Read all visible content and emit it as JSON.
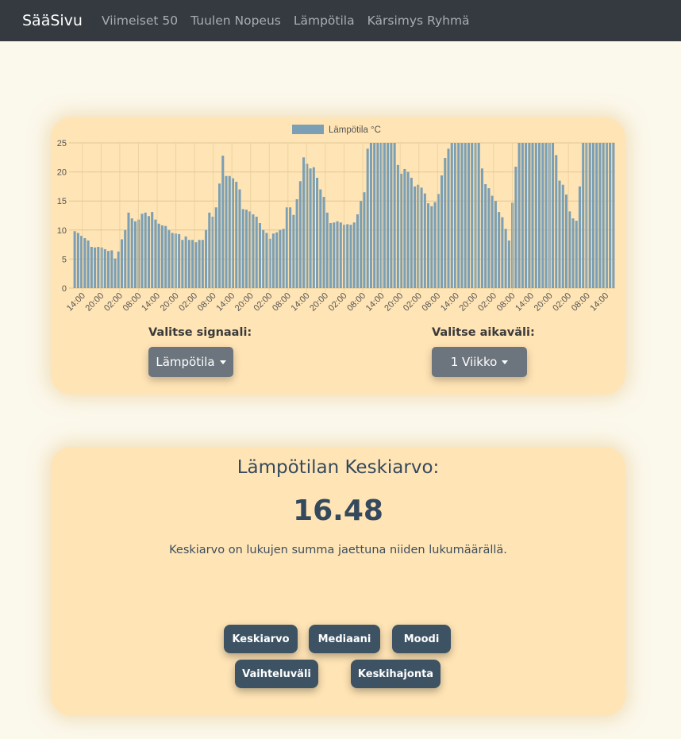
{
  "navbar": {
    "brand": "SääSivu",
    "links": [
      "Viimeiset 50",
      "Tuulen Nopeus",
      "Lämpötila",
      "Kärsimys Ryhmä"
    ]
  },
  "chart_card": {
    "signal_label": "Valitse signaali:",
    "signal_value": "Lämpötila",
    "interval_label": "Valitse aikaväli:",
    "interval_value": "1 Viikko"
  },
  "stats_card": {
    "title": "Lämpötilan Keskiarvo:",
    "value": "16.48",
    "description": "Keskiarvo on lukujen summa jaettuna niiden lukumäärällä.",
    "buttons": [
      "Keskiarvo",
      "Mediaani",
      "Moodi",
      "Vaihteluväli",
      "Keskihajonta"
    ]
  },
  "colors": {
    "bar": "#7b9fb4",
    "grid": "#e2c894",
    "card": "#ffe4b5",
    "button": "#3d5364",
    "dropdown": "#6c757d"
  },
  "chart_data": {
    "type": "bar",
    "legend": [
      "Lämpötila °C"
    ],
    "legend_position": "top",
    "ylim": [
      0,
      25
    ],
    "yticks": [
      "0",
      "5",
      "10",
      "15",
      "20",
      "25"
    ],
    "xticks": [
      "14:00",
      "20:00",
      "02:00",
      "08:00",
      "14:00",
      "20:00",
      "02:00",
      "08:00",
      "14:00",
      "20:00",
      "02:00",
      "08:00",
      "14:00",
      "20:00",
      "02:00",
      "08:00",
      "14:00",
      "20:00",
      "02:00",
      "08:00",
      "14:00",
      "20:00",
      "02:00",
      "08:00",
      "14:00",
      "20:00",
      "02:00",
      "08:00",
      "14:00"
    ],
    "grid": true,
    "series": [
      {
        "name": "Lämpötila °C",
        "values": [
          9.8,
          9.5,
          9,
          8.6,
          8.2,
          7.1,
          7,
          7.1,
          7,
          6.7,
          6.4,
          6.5,
          5.1,
          6.3,
          8.4,
          10,
          13,
          12,
          11.5,
          11.8,
          12.8,
          13,
          12.4,
          13.1,
          11.8,
          11.1,
          10.8,
          10.7,
          10,
          9.5,
          9.4,
          9.3,
          8.3,
          8.9,
          8.3,
          8.3,
          7.9,
          8.3,
          8.3,
          10,
          13,
          12.3,
          13.9,
          18,
          22.8,
          19.3,
          19.3,
          18.9,
          18.3,
          17,
          13.6,
          13.5,
          13.2,
          12.7,
          12.3,
          11.2,
          10,
          9.5,
          8.5,
          9.4,
          9.6,
          10,
          10.2,
          13.9,
          13.9,
          12.6,
          15.3,
          18.4,
          22.5,
          21.4,
          20.6,
          20.8,
          19,
          17,
          15.7,
          13,
          11.2,
          11.3,
          11.5,
          11.3,
          10.9,
          11,
          10.9,
          11.3,
          12.7,
          15,
          16.5,
          24,
          25,
          25,
          25,
          25,
          25,
          25,
          25,
          25,
          21.2,
          19.7,
          20.5,
          20,
          19,
          17.5,
          17.8,
          17.3,
          16.3,
          14.6,
          14.1,
          14.8,
          16.2,
          19.4,
          22.4,
          24,
          25,
          25,
          25,
          25,
          25,
          25,
          25,
          25,
          25,
          20.6,
          17.9,
          17.2,
          15.9,
          15,
          13.1,
          12.2,
          10.2,
          8.2,
          14.7,
          20.9,
          25,
          25,
          25,
          25,
          25,
          25,
          25,
          25,
          25,
          25,
          25,
          22.9,
          18.5,
          17.8,
          16.1,
          13.2,
          12,
          11.6,
          17.5,
          25,
          25,
          25,
          25,
          25,
          25,
          25,
          25,
          25,
          25
        ]
      }
    ]
  }
}
